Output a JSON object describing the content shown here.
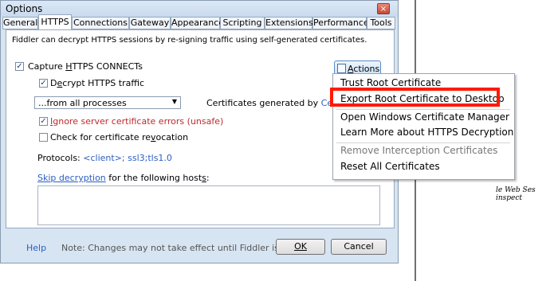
{
  "window": {
    "title": "Options",
    "close_glyph": "×"
  },
  "tabs": [
    "General",
    "HTTPS",
    "Connections",
    "Gateway",
    "Appearance",
    "Scripting",
    "Extensions",
    "Performance",
    "Tools"
  ],
  "https": {
    "intro": "Fiddler can decrypt HTTPS sessions by re-signing traffic using self-generated certificates.",
    "capture": {
      "pre": "Capture ",
      "key": "H",
      "post": "TTPS CONNECTs",
      "checked": true
    },
    "decrypt": {
      "pre": "D",
      "key": "e",
      "post": "crypt HTTPS traffic",
      "checked": true
    },
    "process_select": "...from all processes",
    "cert_generated_label": "Certificates generated by ",
    "cert_generated_link": "CertEnro",
    "ignore_errors": {
      "pre": "",
      "key": "I",
      "post": "gnore server certificate errors (unsafe)",
      "checked": true
    },
    "revocation": {
      "pre": "Check for certificate re",
      "key": "v",
      "post": "ocation",
      "checked": false
    },
    "protocols_label": "Protocols: ",
    "protocols_value": "<client>; ssl3;tls1.0",
    "skip_link": "Skip decryption",
    "skip_text_pre": " for the following host",
    "skip_text_key": "s",
    "skip_text_post": ":",
    "actions": {
      "pre": "",
      "key": "A",
      "post": "ctions"
    },
    "checkmark": "✓"
  },
  "actions_menu": [
    "Trust Root Certificate",
    "Export Root Certificate to Desktop",
    "Open Windows Certificate Manager",
    "Learn More about HTTPS Decryption",
    "Remove Interception Certificates",
    "Reset All Certificates"
  ],
  "footer": {
    "help": "Help",
    "note": "Note: Changes may not take effect until Fiddler is restarted.",
    "ok": "OK",
    "cancel": "Cancel"
  },
  "background": {
    "line1": "le Web Ses",
    "line2": "inspect"
  },
  "colors": {
    "link": "#2a5fc0",
    "error_text": "#c0282b",
    "highlight": "#ff1a00",
    "accent": "#5b8bc6"
  }
}
